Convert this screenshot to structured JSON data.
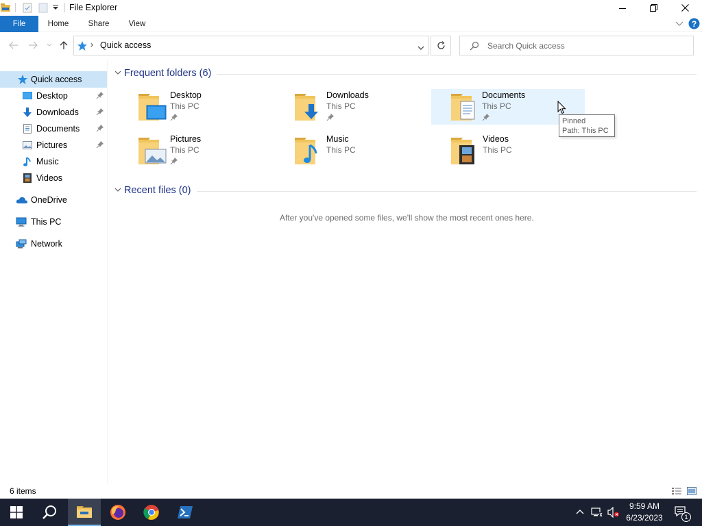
{
  "window": {
    "title": "File Explorer"
  },
  "ribbon": {
    "tabs": [
      "File",
      "Home",
      "Share",
      "View"
    ]
  },
  "address": {
    "location": "Quick access",
    "separator": "›"
  },
  "search": {
    "placeholder": "Search Quick access"
  },
  "navpane": {
    "items": [
      {
        "label": "Quick access",
        "icon": "star-icon",
        "selected": true
      },
      {
        "label": "Desktop",
        "icon": "desktop-icon",
        "pinned": true
      },
      {
        "label": "Downloads",
        "icon": "download-arrow-icon",
        "pinned": true
      },
      {
        "label": "Documents",
        "icon": "document-icon",
        "pinned": true
      },
      {
        "label": "Pictures",
        "icon": "pictures-icon",
        "pinned": true
      },
      {
        "label": "Music",
        "icon": "music-note-icon",
        "pinned": false
      },
      {
        "label": "Videos",
        "icon": "film-icon",
        "pinned": false
      },
      {
        "label": "OneDrive",
        "icon": "cloud-icon"
      },
      {
        "label": "This PC",
        "icon": "computer-icon"
      },
      {
        "label": "Network",
        "icon": "network-icon"
      }
    ]
  },
  "content": {
    "frequent_header": "Frequent folders (6)",
    "recent_header": "Recent files (0)",
    "empty_message": "After you've opened some files, we'll show the most recent ones here.",
    "folders": [
      {
        "name": "Desktop",
        "location": "This PC",
        "pinned": true
      },
      {
        "name": "Downloads",
        "location": "This PC",
        "pinned": true
      },
      {
        "name": "Documents",
        "location": "This PC",
        "pinned": true
      },
      {
        "name": "Pictures",
        "location": "This PC",
        "pinned": true
      },
      {
        "name": "Music",
        "location": "This PC",
        "pinned": false
      },
      {
        "name": "Videos",
        "location": "This PC",
        "pinned": false
      }
    ]
  },
  "tooltip": {
    "line1": "Pinned",
    "line2": "Path: This PC"
  },
  "status": {
    "item_count": "6 items"
  },
  "taskbar": {
    "time": "9:59 AM",
    "date": "6/23/2023",
    "notification_count": "1"
  },
  "colors": {
    "accent": "#1a73c7",
    "selection": "#cce4f7",
    "hover": "#e5f3ff",
    "group_header": "#1e3287",
    "taskbar": "#1b2030"
  }
}
